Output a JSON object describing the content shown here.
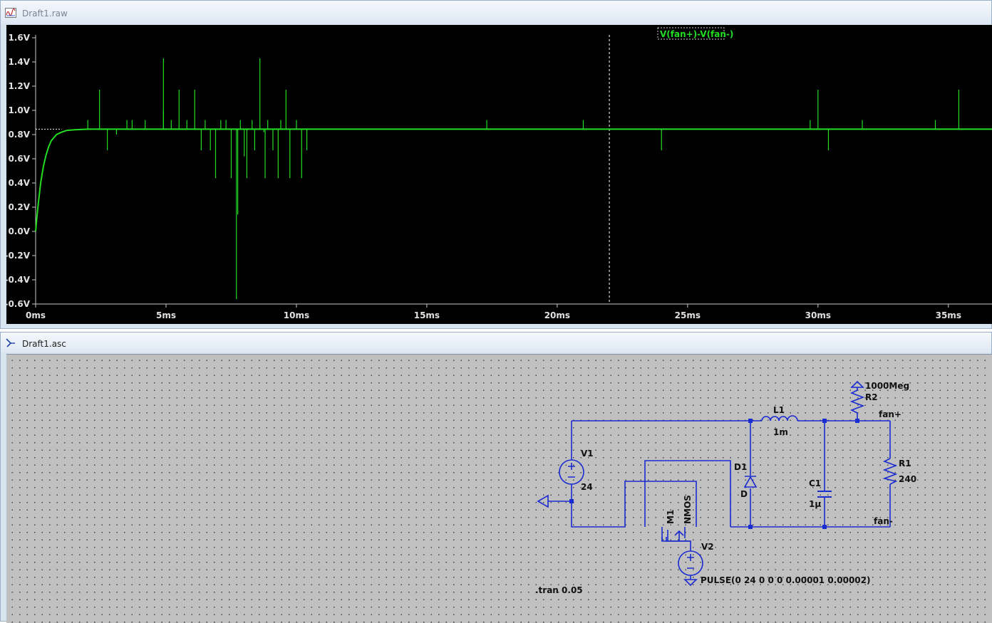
{
  "waveform_window": {
    "title": "Draft1.raw",
    "trace_label": "V(fan+)-V(fan-)",
    "trace_color": "#22dd22",
    "chart_data": {
      "type": "line",
      "title": "",
      "series": [
        {
          "name": "V(fan+)-V(fan-)",
          "x_ms": [
            0,
            0.05,
            0.1,
            0.2,
            0.3,
            0.4,
            0.5,
            0.6,
            0.8,
            1.0,
            1.2,
            1.5,
            2,
            38
          ],
          "y_V": [
            0.0,
            0.12,
            0.23,
            0.41,
            0.54,
            0.63,
            0.7,
            0.75,
            0.8,
            0.82,
            0.835,
            0.84,
            0.845,
            0.845
          ]
        }
      ],
      "baseline_V": 0.845,
      "spikes": [
        {
          "t_ms": 2.0,
          "v": 0.92
        },
        {
          "t_ms": 2.45,
          "v": 1.17
        },
        {
          "t_ms": 2.75,
          "v": 0.67
        },
        {
          "t_ms": 3.1,
          "v": 0.8
        },
        {
          "t_ms": 3.5,
          "v": 0.92
        },
        {
          "t_ms": 3.7,
          "v": 0.92
        },
        {
          "t_ms": 4.2,
          "v": 0.92
        },
        {
          "t_ms": 4.9,
          "v": 1.0
        },
        {
          "t_ms": 5.2,
          "v": 0.92
        },
        {
          "t_ms": 5.5,
          "v": 1.17
        },
        {
          "t_ms": 5.8,
          "v": 0.92
        },
        {
          "t_ms": 6.1,
          "v": 1.17
        },
        {
          "t_ms": 6.35,
          "v": 0.67
        },
        {
          "t_ms": 6.5,
          "v": 0.92
        },
        {
          "t_ms": 6.7,
          "v": 0.67
        },
        {
          "t_ms": 6.9,
          "v": 0.44
        },
        {
          "t_ms": 7.1,
          "v": 0.92
        },
        {
          "t_ms": 7.3,
          "v": 0.92
        },
        {
          "t_ms": 7.5,
          "v": 0.44
        },
        {
          "t_ms": 7.7,
          "v": -0.56
        },
        {
          "t_ms": 7.75,
          "v": 0.14
        },
        {
          "t_ms": 7.85,
          "v": 0.92
        },
        {
          "t_ms": 8.0,
          "v": 0.62
        },
        {
          "t_ms": 8.1,
          "v": 0.44
        },
        {
          "t_ms": 8.3,
          "v": 0.92
        },
        {
          "t_ms": 8.4,
          "v": 0.67
        },
        {
          "t_ms": 8.6,
          "v": 1.43
        },
        {
          "t_ms": 8.8,
          "v": 0.44
        },
        {
          "t_ms": 8.9,
          "v": 0.92
        },
        {
          "t_ms": 9.1,
          "v": 0.67
        },
        {
          "t_ms": 9.3,
          "v": 0.44
        },
        {
          "t_ms": 9.4,
          "v": 0.92
        },
        {
          "t_ms": 9.6,
          "v": 1.17
        },
        {
          "t_ms": 9.75,
          "v": 0.44
        },
        {
          "t_ms": 10.0,
          "v": 0.92
        },
        {
          "t_ms": 10.4,
          "v": 0.67
        },
        {
          "t_ms": 4.9,
          "v": 1.43
        },
        {
          "t_ms": 8.75,
          "v": 0.82
        },
        {
          "t_ms": 10.2,
          "v": 0.44
        },
        {
          "t_ms": 17.3,
          "v": 0.92
        },
        {
          "t_ms": 21.0,
          "v": 0.92
        },
        {
          "t_ms": 24.0,
          "v": 0.67
        },
        {
          "t_ms": 29.7,
          "v": 0.92
        },
        {
          "t_ms": 30.0,
          "v": 1.17
        },
        {
          "t_ms": 30.4,
          "v": 0.67
        },
        {
          "t_ms": 31.7,
          "v": 0.92
        },
        {
          "t_ms": 34.5,
          "v": 0.92
        },
        {
          "t_ms": 35.4,
          "v": 1.17
        }
      ],
      "xlim_ms": [
        0,
        36.7
      ],
      "ylim_V": [
        -0.6,
        1.6
      ],
      "x_ticks": [
        "0ms",
        "5ms",
        "10ms",
        "15ms",
        "20ms",
        "25ms",
        "30ms",
        "35ms"
      ],
      "x_tick_values": [
        0,
        5,
        10,
        15,
        20,
        25,
        30,
        35
      ],
      "y_ticks": [
        "1.6V",
        "1.4V",
        "1.2V",
        "1.0V",
        "0.8V",
        "0.6V",
        "0.4V",
        "0.2V",
        "0.0V",
        "-0.2V",
        "-0.4V",
        "-0.6V"
      ],
      "y_tick_values": [
        1.6,
        1.4,
        1.2,
        1.0,
        0.8,
        0.6,
        0.4,
        0.2,
        0.0,
        -0.2,
        -0.4,
        -0.6
      ],
      "cursor_ms": 22.0,
      "grid": false
    }
  },
  "schematic_window": {
    "title": "Draft1.asc",
    "wire_color": "#1a2bd0",
    "components": {
      "V1": {
        "name": "V1",
        "value": "24"
      },
      "V2": {
        "name": "V2",
        "value": "PULSE(0 24 0 0 0 0.00001 0.00002)"
      },
      "M1": {
        "name": "M1",
        "value": "NMOS"
      },
      "D1": {
        "name": "D1",
        "value": "D"
      },
      "L1": {
        "name": "L1",
        "value": "1m"
      },
      "C1": {
        "name": "C1",
        "value": "1µ"
      },
      "R1": {
        "name": "R1",
        "value": "240"
      },
      "R2": {
        "name": "R2",
        "value": "1000Meg"
      }
    },
    "nets": {
      "fan_plus": "fan+",
      "fan_minus": "fan-"
    },
    "directive": ".tran 0.05"
  }
}
